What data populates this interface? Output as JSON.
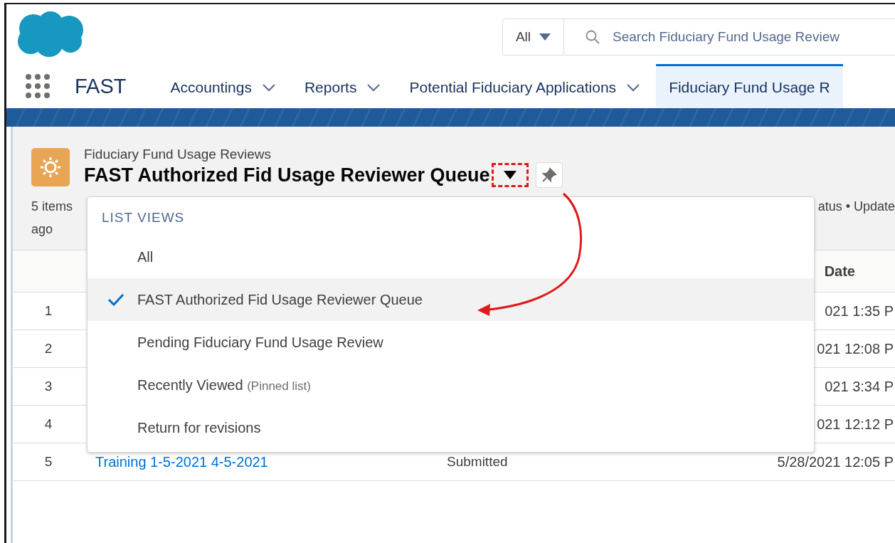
{
  "header": {
    "search": {
      "scope": "All",
      "placeholder": "Search Fiduciary Fund Usage Review"
    }
  },
  "nav": {
    "app_name": "FAST",
    "tabs": [
      {
        "label": "Accountings",
        "selected": false,
        "menu": true
      },
      {
        "label": "Reports",
        "selected": false,
        "menu": true
      },
      {
        "label": "Potential Fiduciary Applications",
        "selected": false,
        "menu": true
      },
      {
        "label": "Fiduciary Fund Usage R",
        "selected": true
      }
    ]
  },
  "list_header": {
    "object_name": "Fiduciary Fund Usage Reviews",
    "title": "FAST Authorized Fid Usage Reviewer Queue",
    "meta_left": "5 items ago",
    "meta_right": "atus • Update"
  },
  "table": {
    "date_header": "Date",
    "rows": [
      {
        "number": "1",
        "date": "021 1:35 P"
      },
      {
        "number": "2",
        "date": "021 12:08 P"
      },
      {
        "number": "3",
        "date": "021 3:34 P"
      },
      {
        "number": "4",
        "date": "021 12:12 P"
      },
      {
        "number": "5",
        "name": "Training 1-5-2021 4-5-2021",
        "status": "Submitted",
        "date": "5/28/2021 12:05 P"
      }
    ]
  },
  "list_views_menu": {
    "heading": "LIST VIEWS",
    "items": [
      {
        "label": "All",
        "selected": false
      },
      {
        "label": "FAST Authorized Fid Usage Reviewer Queue",
        "selected": true
      },
      {
        "label": "Pending Fiduciary Fund Usage Review",
        "selected": false
      },
      {
        "label": "Recently Viewed",
        "note": "(Pinned list)",
        "selected": false
      },
      {
        "label": "Return for revisions",
        "selected": false
      }
    ]
  }
}
